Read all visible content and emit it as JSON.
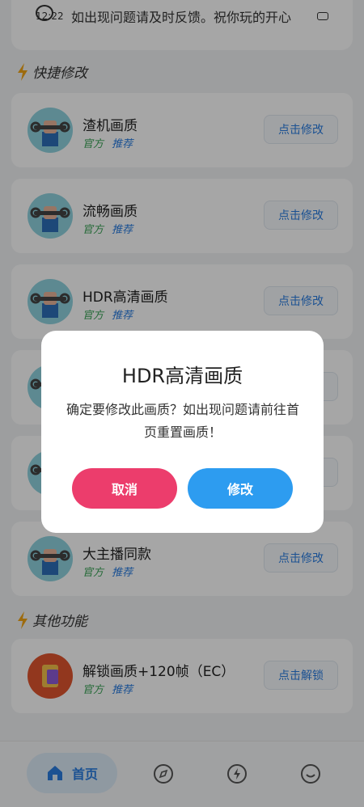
{
  "status": {
    "time": "12:22",
    "notice": "如出现问题请及时反馈。祝你玩的开心"
  },
  "sections": {
    "quick": "快捷修改",
    "other": "其他功能"
  },
  "tags": {
    "official": "官方",
    "recommend": "推荐"
  },
  "cards": [
    {
      "title": "渣机画质",
      "action": "点击修改"
    },
    {
      "title": "流畅画质",
      "action": "点击修改"
    },
    {
      "title": "HDR高清画质",
      "action": "点击修改"
    },
    {
      "title": "",
      "action": "点击修改"
    },
    {
      "title": "",
      "action": "点击修改"
    },
    {
      "title": "大主播同款",
      "action": "点击修改"
    }
  ],
  "other_card": {
    "title": "解锁画质+120帧（EC）",
    "action": "点击解锁"
  },
  "tabbar": {
    "home": "首页"
  },
  "dialog": {
    "title": "HDR高清画质",
    "message": "确定要修改此画质？如出现问题请前往首页重置画质！",
    "cancel": "取消",
    "confirm": "修改"
  },
  "colors": {
    "accent": "#2a7de1",
    "cancel": "#ec3d6c",
    "confirm": "#2d9cf0",
    "official": "#3aa457"
  }
}
